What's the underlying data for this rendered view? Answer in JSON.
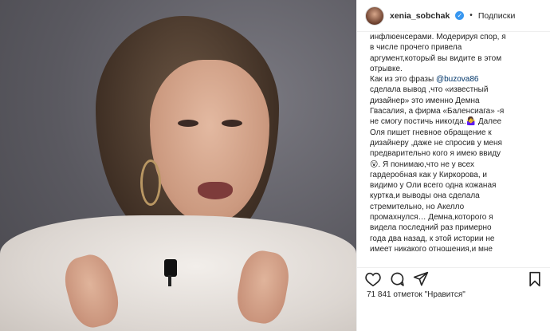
{
  "header": {
    "username": "xenia_sobchak",
    "separator": "•",
    "follow_label": "Подписки"
  },
  "caption": {
    "lines_before_mention": "инфлюенсерами. Модерируя спор, я\nв числе прочего привела\nаргумент,который вы видите в этом\nотрывке.\nКак из это фразы ",
    "mention": "@buzova86",
    "lines_after_mention": "\nсделала вывод ,что «известный\nдизайнер» это именно Демна\nГвасалия, а фирма «Баленсиага» -я\nне смогу постичь никогда.🤷‍♀️ Далее\nОля пишет гневное обращение к\nдизайнеру ,даже не спросив у меня\nпредварительно кого я имею ввиду\n😮. Я понимаю,что не у всех\nгардеробная как у Киркорова, и\nвидимо у Оли всего одна кожаная\nкуртка,и выводы она сделала\nстремительно, но Акелло\nпромахнулся… Демна,которого я\nвидела последний раз примерно\nгода два назад, к этой истории не\nимеет никакого отношения,и мне"
  },
  "actions": {
    "like_icon": "heart-icon",
    "comment_icon": "comment-icon",
    "share_icon": "share-icon",
    "save_icon": "bookmark-icon"
  },
  "likes_text": "71 841 отметок \"Нравится\"",
  "colors": {
    "verified": "#3897f0",
    "mention": "#003569",
    "text": "#262626",
    "divider": "#efefef"
  }
}
